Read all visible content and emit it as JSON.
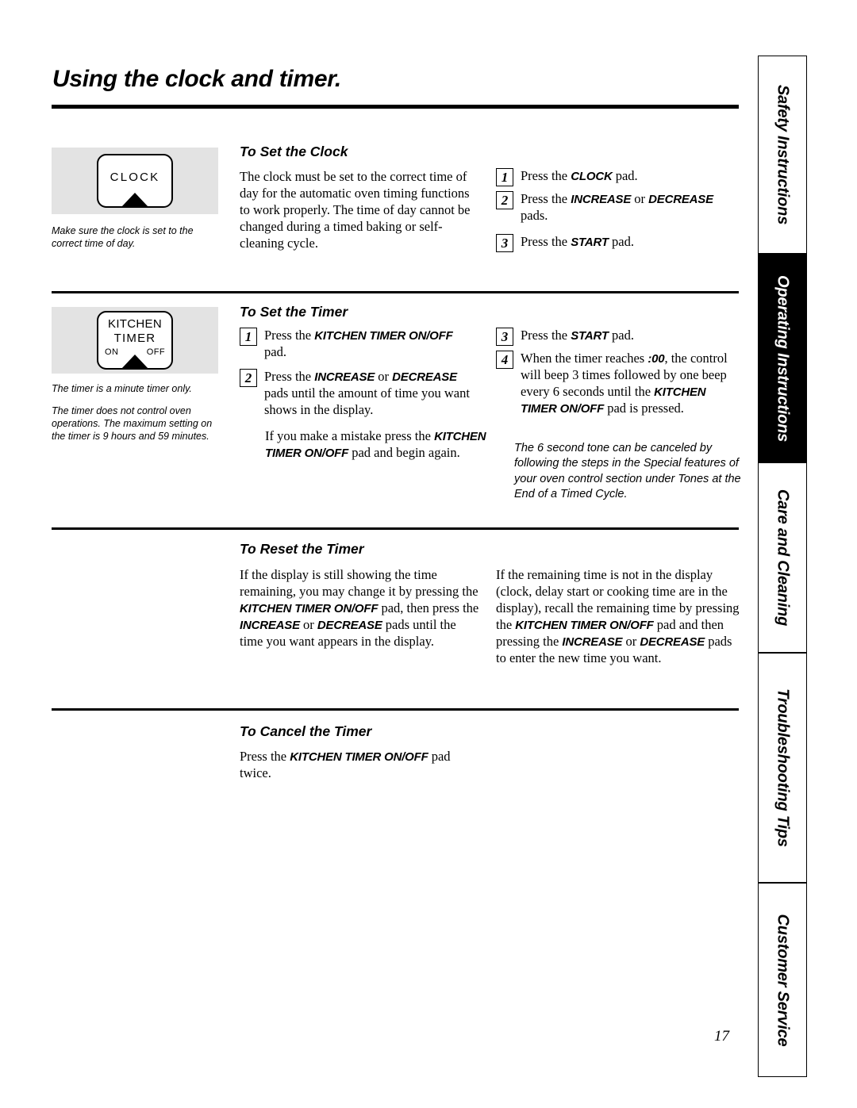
{
  "page": {
    "title": "Using the clock and timer.",
    "number": "17"
  },
  "sidebar": {
    "tabs": [
      {
        "label": "Safety Instructions",
        "active": false
      },
      {
        "label": "Operating Instructions",
        "active": true
      },
      {
        "label": "Care and Cleaning",
        "active": false
      },
      {
        "label": "Troubleshooting Tips",
        "active": false
      },
      {
        "label": "Customer Service",
        "active": false
      }
    ]
  },
  "illustrations": {
    "clock_pad": {
      "label": "CLOCK"
    },
    "timer_pad": {
      "line1": "KITCHEN",
      "line2": "TIMER",
      "on": "ON",
      "off": "OFF"
    }
  },
  "notes": {
    "clock": "Make sure the clock is set to the correct time of day.",
    "timer_1": "The timer is a minute timer only.",
    "timer_2": "The timer does not control oven operations. The maximum setting on the timer is 9 hours and 59 minutes."
  },
  "sections": {
    "set_clock": {
      "heading": "To Set the Clock",
      "paragraph": "The clock must be set to the correct time of day for the automatic oven timing functions to work properly. The time of day cannot be changed during a timed baking or self-cleaning cycle.",
      "steps": [
        {
          "num": "1",
          "text_html": "Press the <b class=\"pd\">CLOCK</b> pad."
        },
        {
          "num": "2",
          "text_html": "Press the <b class=\"pd\">INCREASE</b> or <b class=\"pd\">DECREASE</b> pads."
        },
        {
          "num": "3",
          "text_html": "Press the <b class=\"pd\">START</b> pad."
        }
      ]
    },
    "set_timer": {
      "heading": "To Set the Timer",
      "steps": [
        {
          "num": "1",
          "text_html": "Press the <b class=\"pd\">KITCHEN TIMER ON/OFF</b> pad."
        },
        {
          "num": "2",
          "text_html": "Press the <b class=\"pd\">INCREASE</b> or <b class=\"pd\">DECREASE</b> pads until the amount of time you want shows in the display."
        },
        {
          "num": "3",
          "text_html": "Press the <b class=\"pd\">START</b> pad."
        },
        {
          "num": "4",
          "text_html": "When the timer reaches <b class=\"pd\">:00</b>, the control will beep 3 times followed by one beep every 6 seconds until the <b class=\"pd\">KITCHEN TIMER ON/OFF</b> pad is pressed."
        }
      ],
      "mistake_html": "If you make a mistake press the <b class=\"pd\">KITCHEN TIMER ON/OFF</b> pad and begin again.",
      "callout": "The 6 second tone can be canceled by following the steps in the Special features of your oven control section under Tones at the End of a Timed Cycle."
    },
    "reset_timer": {
      "heading": "To Reset the Timer",
      "left_html": "If the display is still showing the time remaining, you may change it by pressing the <b class=\"pd\">KITCHEN TIMER ON/OFF</b> pad, then press the <b class=\"pd\">INCREASE</b> or <b class=\"pd\">DECREASE</b> pads until the time you want appears in the display.",
      "right_html": "If the remaining time is not in the display (clock, delay start or cooking time are in the display), recall the remaining time by pressing the <b class=\"pd\">KITCHEN TIMER ON/OFF</b> pad and then pressing the <b class=\"pd\">INCREASE</b> or <b class=\"pd\">DECREASE</b> pads to enter the new time you want."
    },
    "cancel_timer": {
      "heading": "To Cancel the Timer",
      "paragraph_html": "Press the <b class=\"pd\">KITCHEN TIMER ON/OFF</b> pad twice."
    }
  }
}
